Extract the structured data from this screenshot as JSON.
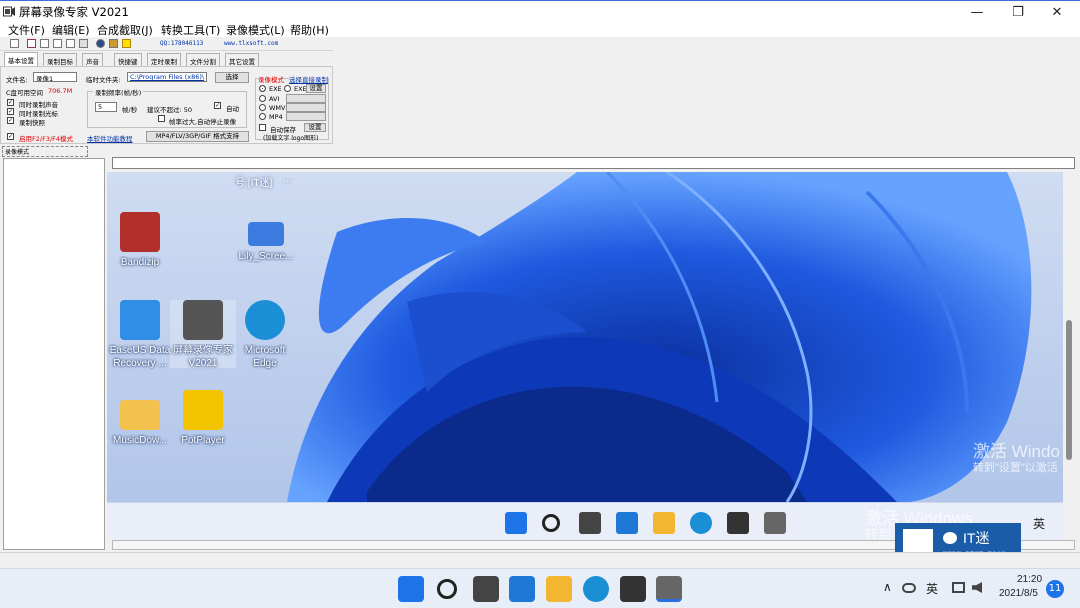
{
  "window": {
    "title": "屏幕录像专家 V2021",
    "minimize": "—",
    "maximize": "❐",
    "close": "✕"
  },
  "menu": [
    "文件(F)",
    "编辑(E)",
    "合成截取(J)",
    "转换工具(T)",
    "录像模式(L)",
    "帮助(H)"
  ],
  "toolbar": {
    "qq": "QQ:178046113",
    "website": "www.tlxsoft.com"
  },
  "tabs": [
    "基本设置",
    "录制目标",
    "声音",
    "快捷键",
    "定时录制",
    "文件分割",
    "其它设置"
  ],
  "basic": {
    "filename_label": "文件名:",
    "filename_value": "录像1",
    "temp_folder_label": "临时文件夹:",
    "temp_folder_value": "C:\\Program Files (x86)\\",
    "choose_btn": "选择",
    "disk_space_label": "C盘可用空间",
    "disk_space_value": "706.7M",
    "record_sound": "同时录制声音",
    "record_cursor": "同时录制光标",
    "record_hotkey": "录制快照",
    "enable_f2": "启用F2/F3/F4模式",
    "software_help": "本软件功能教程",
    "frequency_group": "录制频率(帧/秒)",
    "fps_value": "5",
    "fps_unit": "帧/秒",
    "fps_max_label": "建议不超过: 50",
    "auto_label": "自动",
    "stop_label": "帧率过大,自动停止录像",
    "format_btn": "MP4/FLV/3GP/GIF  格式支持",
    "direct_label": "录像模式",
    "direct_link": "选择直接录制",
    "opt_lxe": "EXE",
    "opt_exe": "EXE",
    "opt_avi": "AVI",
    "opt_wmv": "WMV",
    "opt_mp4": "MP4",
    "setting_btn": "设置",
    "auto_stop": "自动保存",
    "text_logo": "(加载文字 logo图形)"
  },
  "mode_bar": "录像模式",
  "desktop": {
    "icons": [
      {
        "label": "Bandizip",
        "color": "#b2302b"
      },
      {
        "label": "Lily_Scree...",
        "color": "#3c7be0"
      },
      {
        "label": "EaseUS Data Recovery ...",
        "color": "#2f8ee6"
      },
      {
        "label": "屏幕录像专家 V2021",
        "color": "#555555"
      },
      {
        "label": "Microsoft Edge",
        "color": "#1a8fd6"
      },
      {
        "label": "MusicDow...",
        "color": "#f2c14e"
      },
      {
        "label": "PotPlayer",
        "color": "#f5c400"
      }
    ],
    "partial_top": [
      "号 [IT迷]",
      "..."
    ],
    "watermark1_title": "激活 Windo",
    "watermark1_sub": "转到\"设置\"以激活",
    "watermark2_title": "激活 Windows",
    "watermark2_sub": "转到",
    "ime": "英"
  },
  "it_badge": {
    "name": "IT迷",
    "sub": "智能数码 · 电脑技巧 · 软件分享"
  },
  "taskbar": {
    "ime": "英",
    "time": "21:20",
    "date": "2021/8/5",
    "notification_count": "11",
    "chevron": "∧"
  }
}
